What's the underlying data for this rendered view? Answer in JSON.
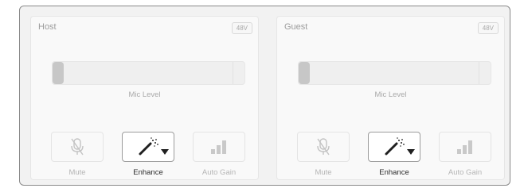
{
  "panels": [
    {
      "title": "Host",
      "phantom_label": "48V",
      "fader_label": "Mic Level",
      "mic_level": 0,
      "buttons": {
        "mute": "Mute",
        "enhance": "Enhance",
        "auto_gain": "Auto Gain"
      }
    },
    {
      "title": "Guest",
      "phantom_label": "48V",
      "fader_label": "Mic Level",
      "mic_level": 0,
      "buttons": {
        "mute": "Mute",
        "enhance": "Enhance",
        "auto_gain": "Auto Gain"
      }
    }
  ],
  "icons": {
    "mute": "microphone-muted-icon",
    "enhance": "magic-wand-icon",
    "auto_gain": "signal-bars-icon",
    "enhance_dropdown": "caret-down-icon"
  },
  "colors": {
    "enhance_active_border": "#9c9c9c",
    "disabled_text": "#b5b5b5",
    "active_text": "#2a2a2a"
  }
}
